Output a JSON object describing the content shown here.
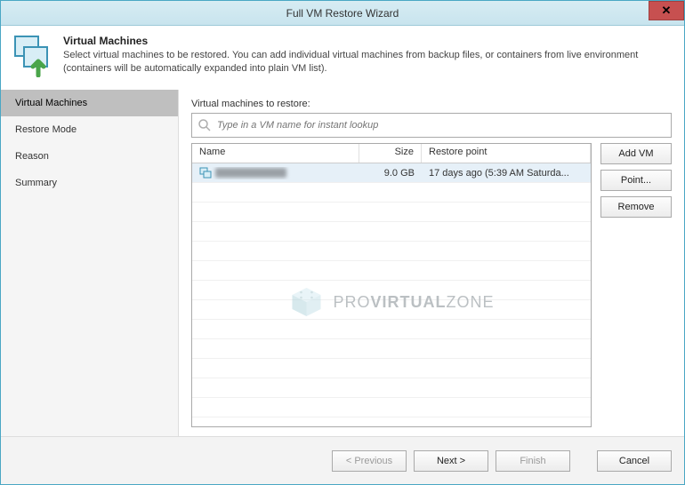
{
  "window": {
    "title": "Full VM Restore Wizard"
  },
  "header": {
    "title": "Virtual Machines",
    "description": "Select virtual machines to be restored. You can add individual virtual machines from backup files, or containers from live environment (containers will be automatically expanded into plain VM list)."
  },
  "sidebar": {
    "items": [
      {
        "label": "Virtual Machines",
        "active": true
      },
      {
        "label": "Restore Mode",
        "active": false
      },
      {
        "label": "Reason",
        "active": false
      },
      {
        "label": "Summary",
        "active": false
      }
    ]
  },
  "main": {
    "label": "Virtual machines to restore:",
    "search": {
      "placeholder": "Type in a VM name for instant lookup"
    },
    "columns": {
      "name": "Name",
      "size": "Size",
      "restore_point": "Restore point"
    },
    "rows": [
      {
        "name": "(redacted)",
        "size": "9.0 GB",
        "restore_point": "17 days ago (5:39 AM Saturda..."
      }
    ],
    "buttons": {
      "add_vm": "Add VM",
      "point": "Point...",
      "remove": "Remove"
    },
    "watermark": {
      "pre": "PRO",
      "mid": "VIRTUAL",
      "post": "ZONE"
    }
  },
  "footer": {
    "previous": "< Previous",
    "next": "Next >",
    "finish": "Finish",
    "cancel": "Cancel"
  }
}
